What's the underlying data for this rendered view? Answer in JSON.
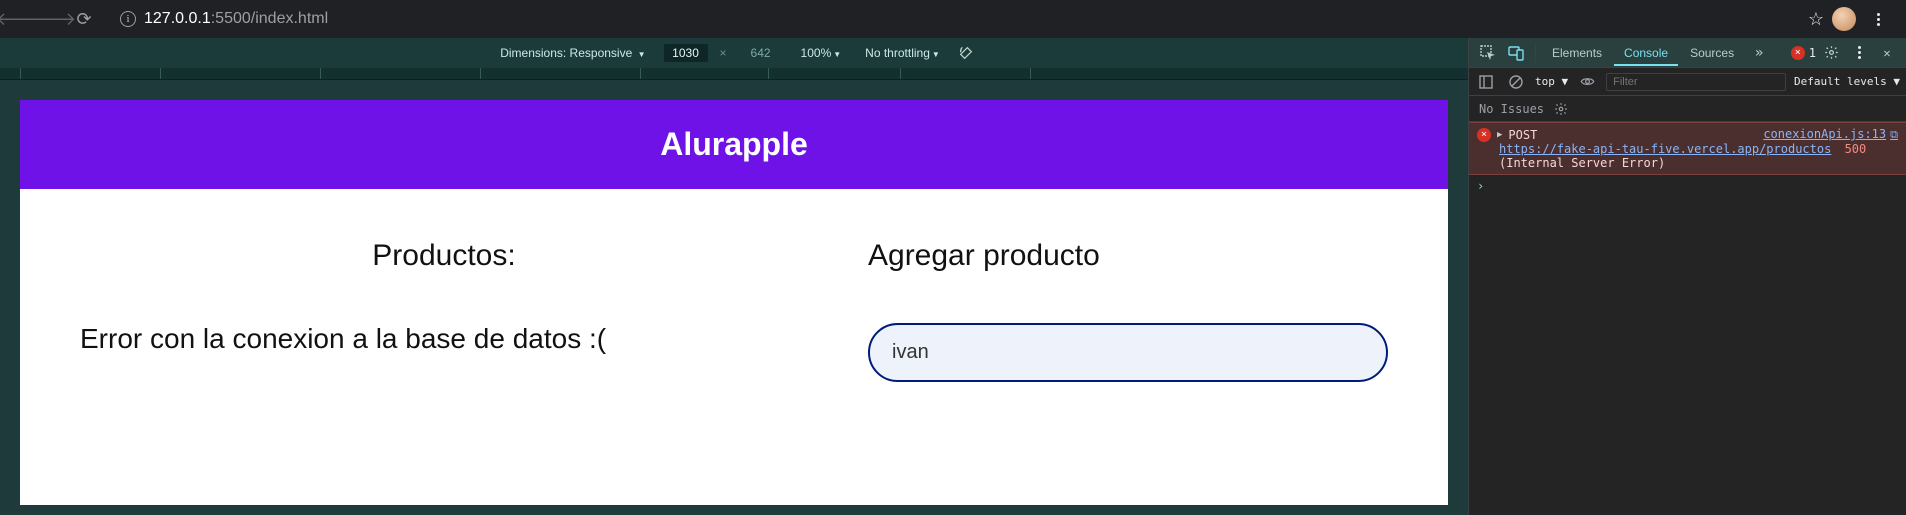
{
  "browser": {
    "url_host": "127.0.0.1",
    "url_rest": ":5500/index.html"
  },
  "device_toolbar": {
    "dimensions_label": "Dimensions: Responsive",
    "width": "1030",
    "height": "642",
    "zoom": "100%",
    "throttling": "No throttling"
  },
  "app": {
    "title": "Alurapple",
    "products_heading": "Productos:",
    "error_message": "Error con la conexion a la base de datos :(",
    "form_heading": "Agregar producto",
    "input_value": "ivan",
    "input_placeholder": ""
  },
  "devtools": {
    "tabs": {
      "elements": "Elements",
      "console": "Console",
      "sources": "Sources"
    },
    "error_count": "1",
    "filter": {
      "context": "top",
      "placeholder": "Filter",
      "levels": "Default levels"
    },
    "issues_label": "No Issues",
    "log": {
      "method": "POST",
      "source": "conexionApi.js:13",
      "url": "https://fake-api-tau-five.vercel.app/productos",
      "status_code": "500",
      "status_text": "(Internal Server Error)"
    }
  }
}
